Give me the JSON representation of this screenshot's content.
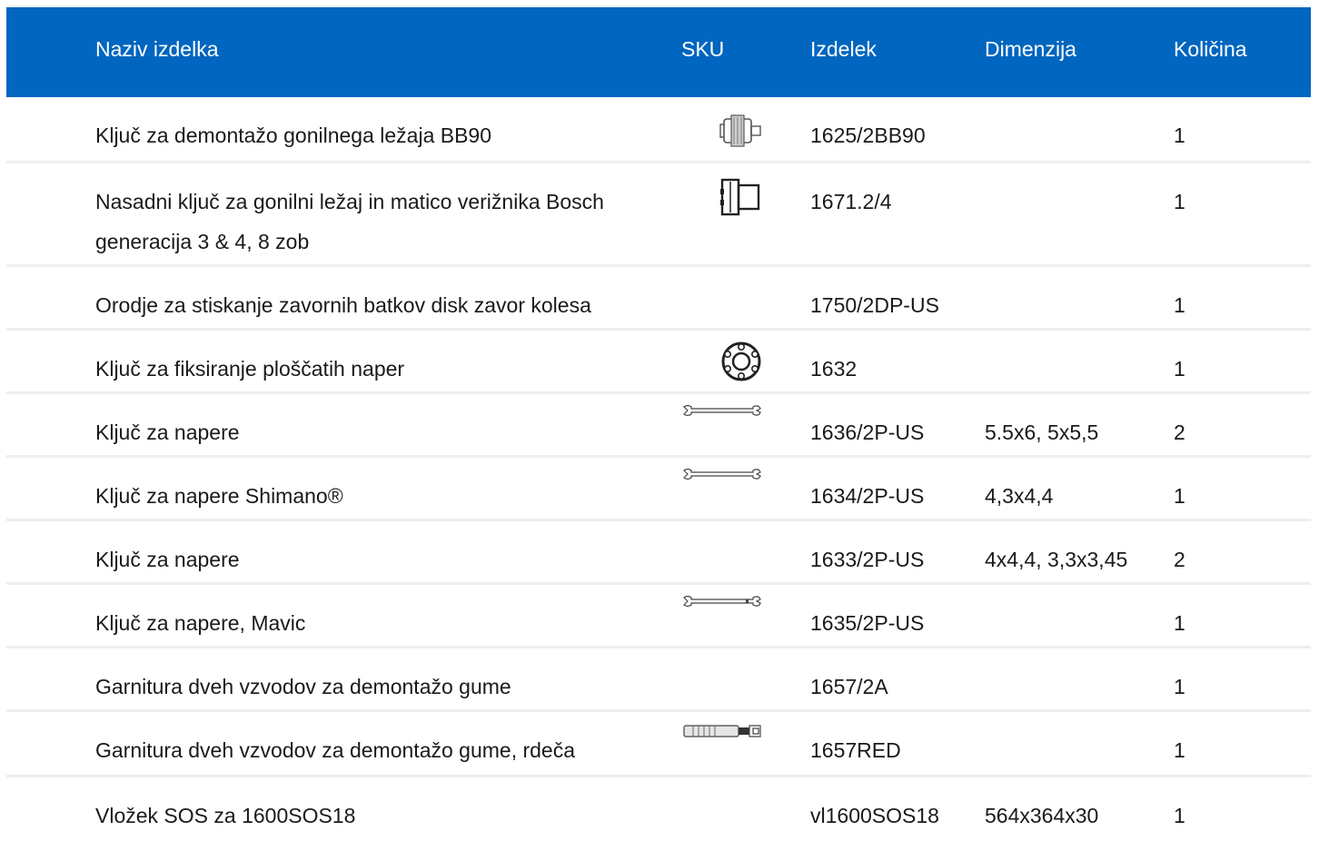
{
  "header": {
    "name": "Naziv izdelka",
    "sku": "SKU",
    "product": "Izdelek",
    "dimension": "Dimenzija",
    "quantity": "Količina"
  },
  "rows": [
    {
      "name": "Ključ za demontažo gonilnega ležaja BB90",
      "icon": "bb90-bearing-tool-icon",
      "code": "1625/2BB90",
      "dim": "",
      "qty": "1"
    },
    {
      "name": "Nasadni ključ za gonilni ležaj in matico verižnika Bosch generacija 3 & 4, 8 zob",
      "icon": "socket-wrench-icon",
      "code": "1671.2/4",
      "dim": "",
      "qty": "1"
    },
    {
      "name": "Orodje za stiskanje zavornih batkov disk zavor kolesa",
      "icon": "",
      "code": "1750/2DP-US",
      "dim": "",
      "qty": "1"
    },
    {
      "name": "Ključ za fiksiranje ploščatih naper",
      "icon": "ring-spanner-icon",
      "code": "1632",
      "dim": "",
      "qty": "1"
    },
    {
      "name": "Ključ za napere",
      "icon": "spoke-wrench-icon",
      "code": "1636/2P-US",
      "dim": "5.5x6, 5x5,5",
      "qty": "2"
    },
    {
      "name": "Ključ za napere Shimano®",
      "icon": "spoke-wrench-icon",
      "code": "1634/2P-US",
      "dim": "4,3x4,4",
      "qty": "1"
    },
    {
      "name": "Ključ za napere",
      "icon": "",
      "code": "1633/2P-US",
      "dim": "4x4,4, 3,3x3,45",
      "qty": "2"
    },
    {
      "name": "Ključ za napere, Mavic",
      "icon": "spoke-wrench-icon",
      "code": "1635/2P-US",
      "dim": "",
      "qty": "1"
    },
    {
      "name": "Garnitura dveh vzvodov za demontažo gume",
      "icon": "",
      "code": "1657/2A",
      "dim": "",
      "qty": "1"
    },
    {
      "name": "Garnitura dveh vzvodov za demontažo gume, rdeča",
      "icon": "tire-lever-icon",
      "code": "1657RED",
      "dim": "",
      "qty": "1"
    },
    {
      "name": "Vložek SOS za 1600SOS18",
      "icon": "",
      "code": "vl1600SOS18",
      "dim": "564x364x30",
      "qty": "1"
    }
  ],
  "colors": {
    "header_bg": "#0066bf",
    "header_text": "#ffffff",
    "row_divider": "#eeeeee",
    "text": "#1a1a1a"
  }
}
